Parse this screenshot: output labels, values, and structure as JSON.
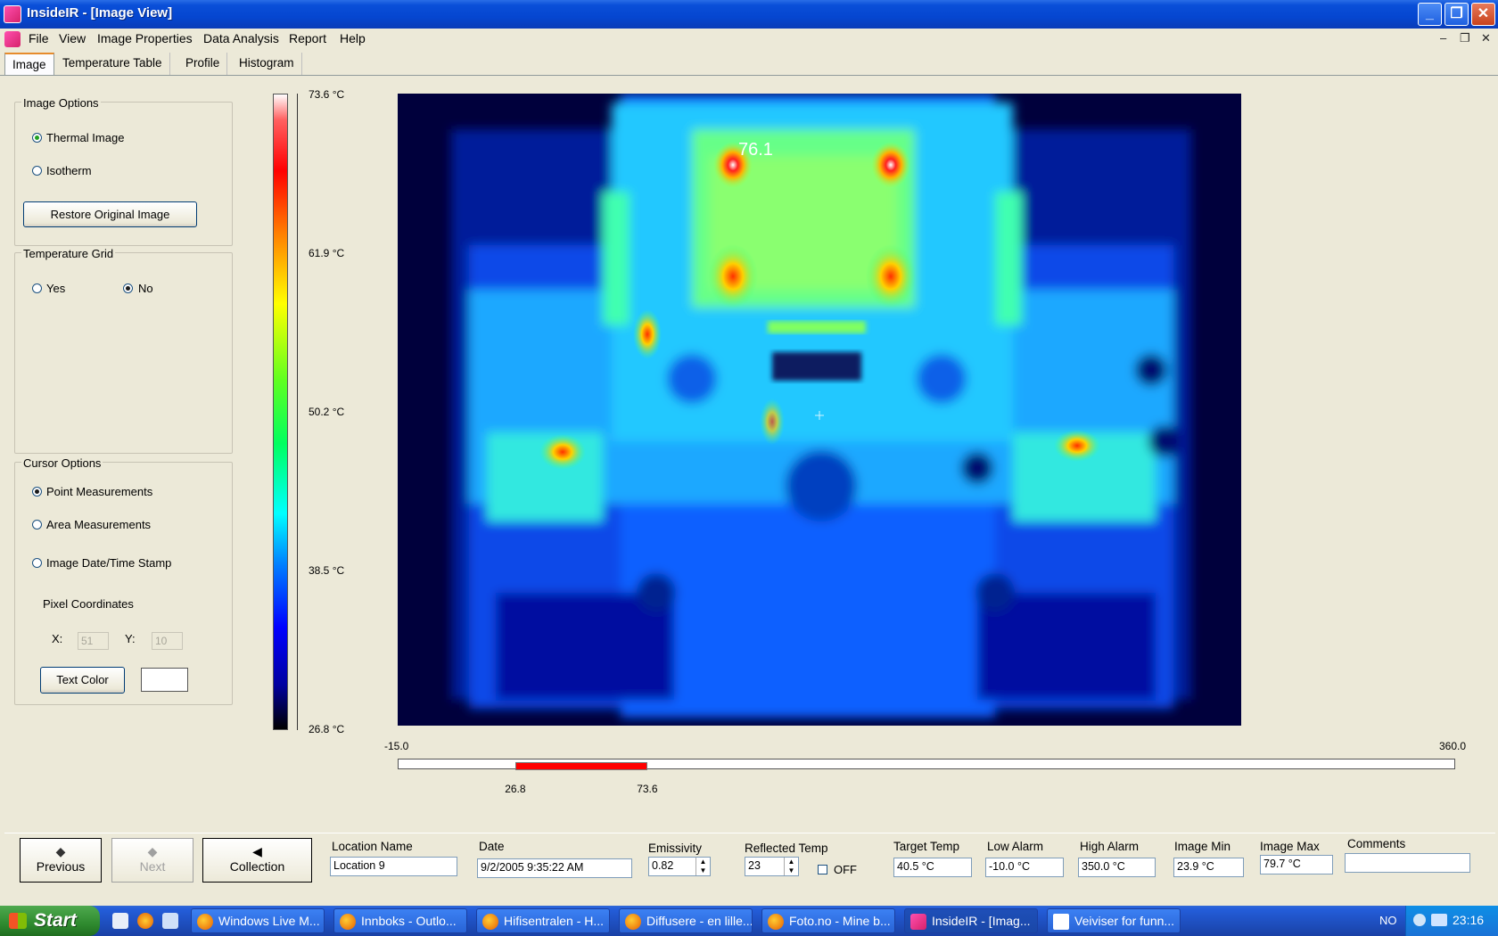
{
  "window": {
    "title": "InsideIR - [Image View]"
  },
  "menu": [
    "File",
    "View",
    "Image Properties",
    "Data Analysis",
    "Report",
    "Help"
  ],
  "mdi_controls": [
    "–",
    "❐",
    "✕"
  ],
  "tabs": [
    "Image",
    "Temperature Table",
    "Profile",
    "Histogram"
  ],
  "image_options": {
    "title": "Image Options",
    "thermal_label": "Thermal Image",
    "isotherm_label": "Isotherm",
    "restore_label": "Restore Original Image",
    "selected": "Thermal Image"
  },
  "temperature_grid": {
    "title": "Temperature Grid",
    "yes_label": "Yes",
    "no_label": "No",
    "selected": "No"
  },
  "cursor_options": {
    "title": "Cursor Options",
    "point_label": "Point Measurements",
    "area_label": "Area Measurements",
    "stamp_label": "Image Date/Time Stamp",
    "selected": "Point Measurements",
    "pixel_coords_label": "Pixel Coordinates",
    "x_label": "X:",
    "x_value": "51",
    "y_label": "Y:",
    "y_value": "10",
    "text_color_label": "Text Color"
  },
  "colorbar": {
    "ticks": [
      "73.6 °C",
      "61.9 °C",
      "50.2 °C",
      "38.5 °C",
      "26.8 °C"
    ]
  },
  "thermal": {
    "hot_label": "76.1"
  },
  "scale": {
    "min_label": "-15.0",
    "max_label": "360.0",
    "low_label": "26.8",
    "high_label": "73.6",
    "min": -15.0,
    "max": 360.0,
    "low": 26.8,
    "high": 73.6
  },
  "bottom": {
    "previous_label": "Previous",
    "next_label": "Next",
    "collection_label": "Collection",
    "location_name_label": "Location Name",
    "location_name_value": "Location 9",
    "date_label": "Date",
    "date_value": "9/2/2005 9:35:22 AM",
    "emissivity_label": "Emissivity",
    "emissivity_value": "0.82",
    "reflected_temp_label": "Reflected Temp",
    "reflected_temp_value": "23",
    "off_label": "OFF",
    "target_temp_label": "Target Temp",
    "target_temp_value": "40.5 °C",
    "low_alarm_label": "Low Alarm",
    "low_alarm_value": "-10.0 °C",
    "high_alarm_label": "High Alarm",
    "high_alarm_value": "350.0 °C",
    "image_min_label": "Image Min",
    "image_min_value": "23.9 °C",
    "image_max_label": "Image Max",
    "image_max_value": "79.7 °C",
    "comments_label": "Comments",
    "comments_value": ""
  },
  "taskbar": {
    "start_label": "Start",
    "tasks": [
      "Windows Live M...",
      "Innboks - Outlo...",
      "Hifisentralen - H...",
      "Diffusere - en lille...",
      "Foto.no - Mine b...",
      "InsideIR - [Imag...",
      "Veiviser for funn..."
    ],
    "lang": "NO",
    "clock": "23:16"
  }
}
